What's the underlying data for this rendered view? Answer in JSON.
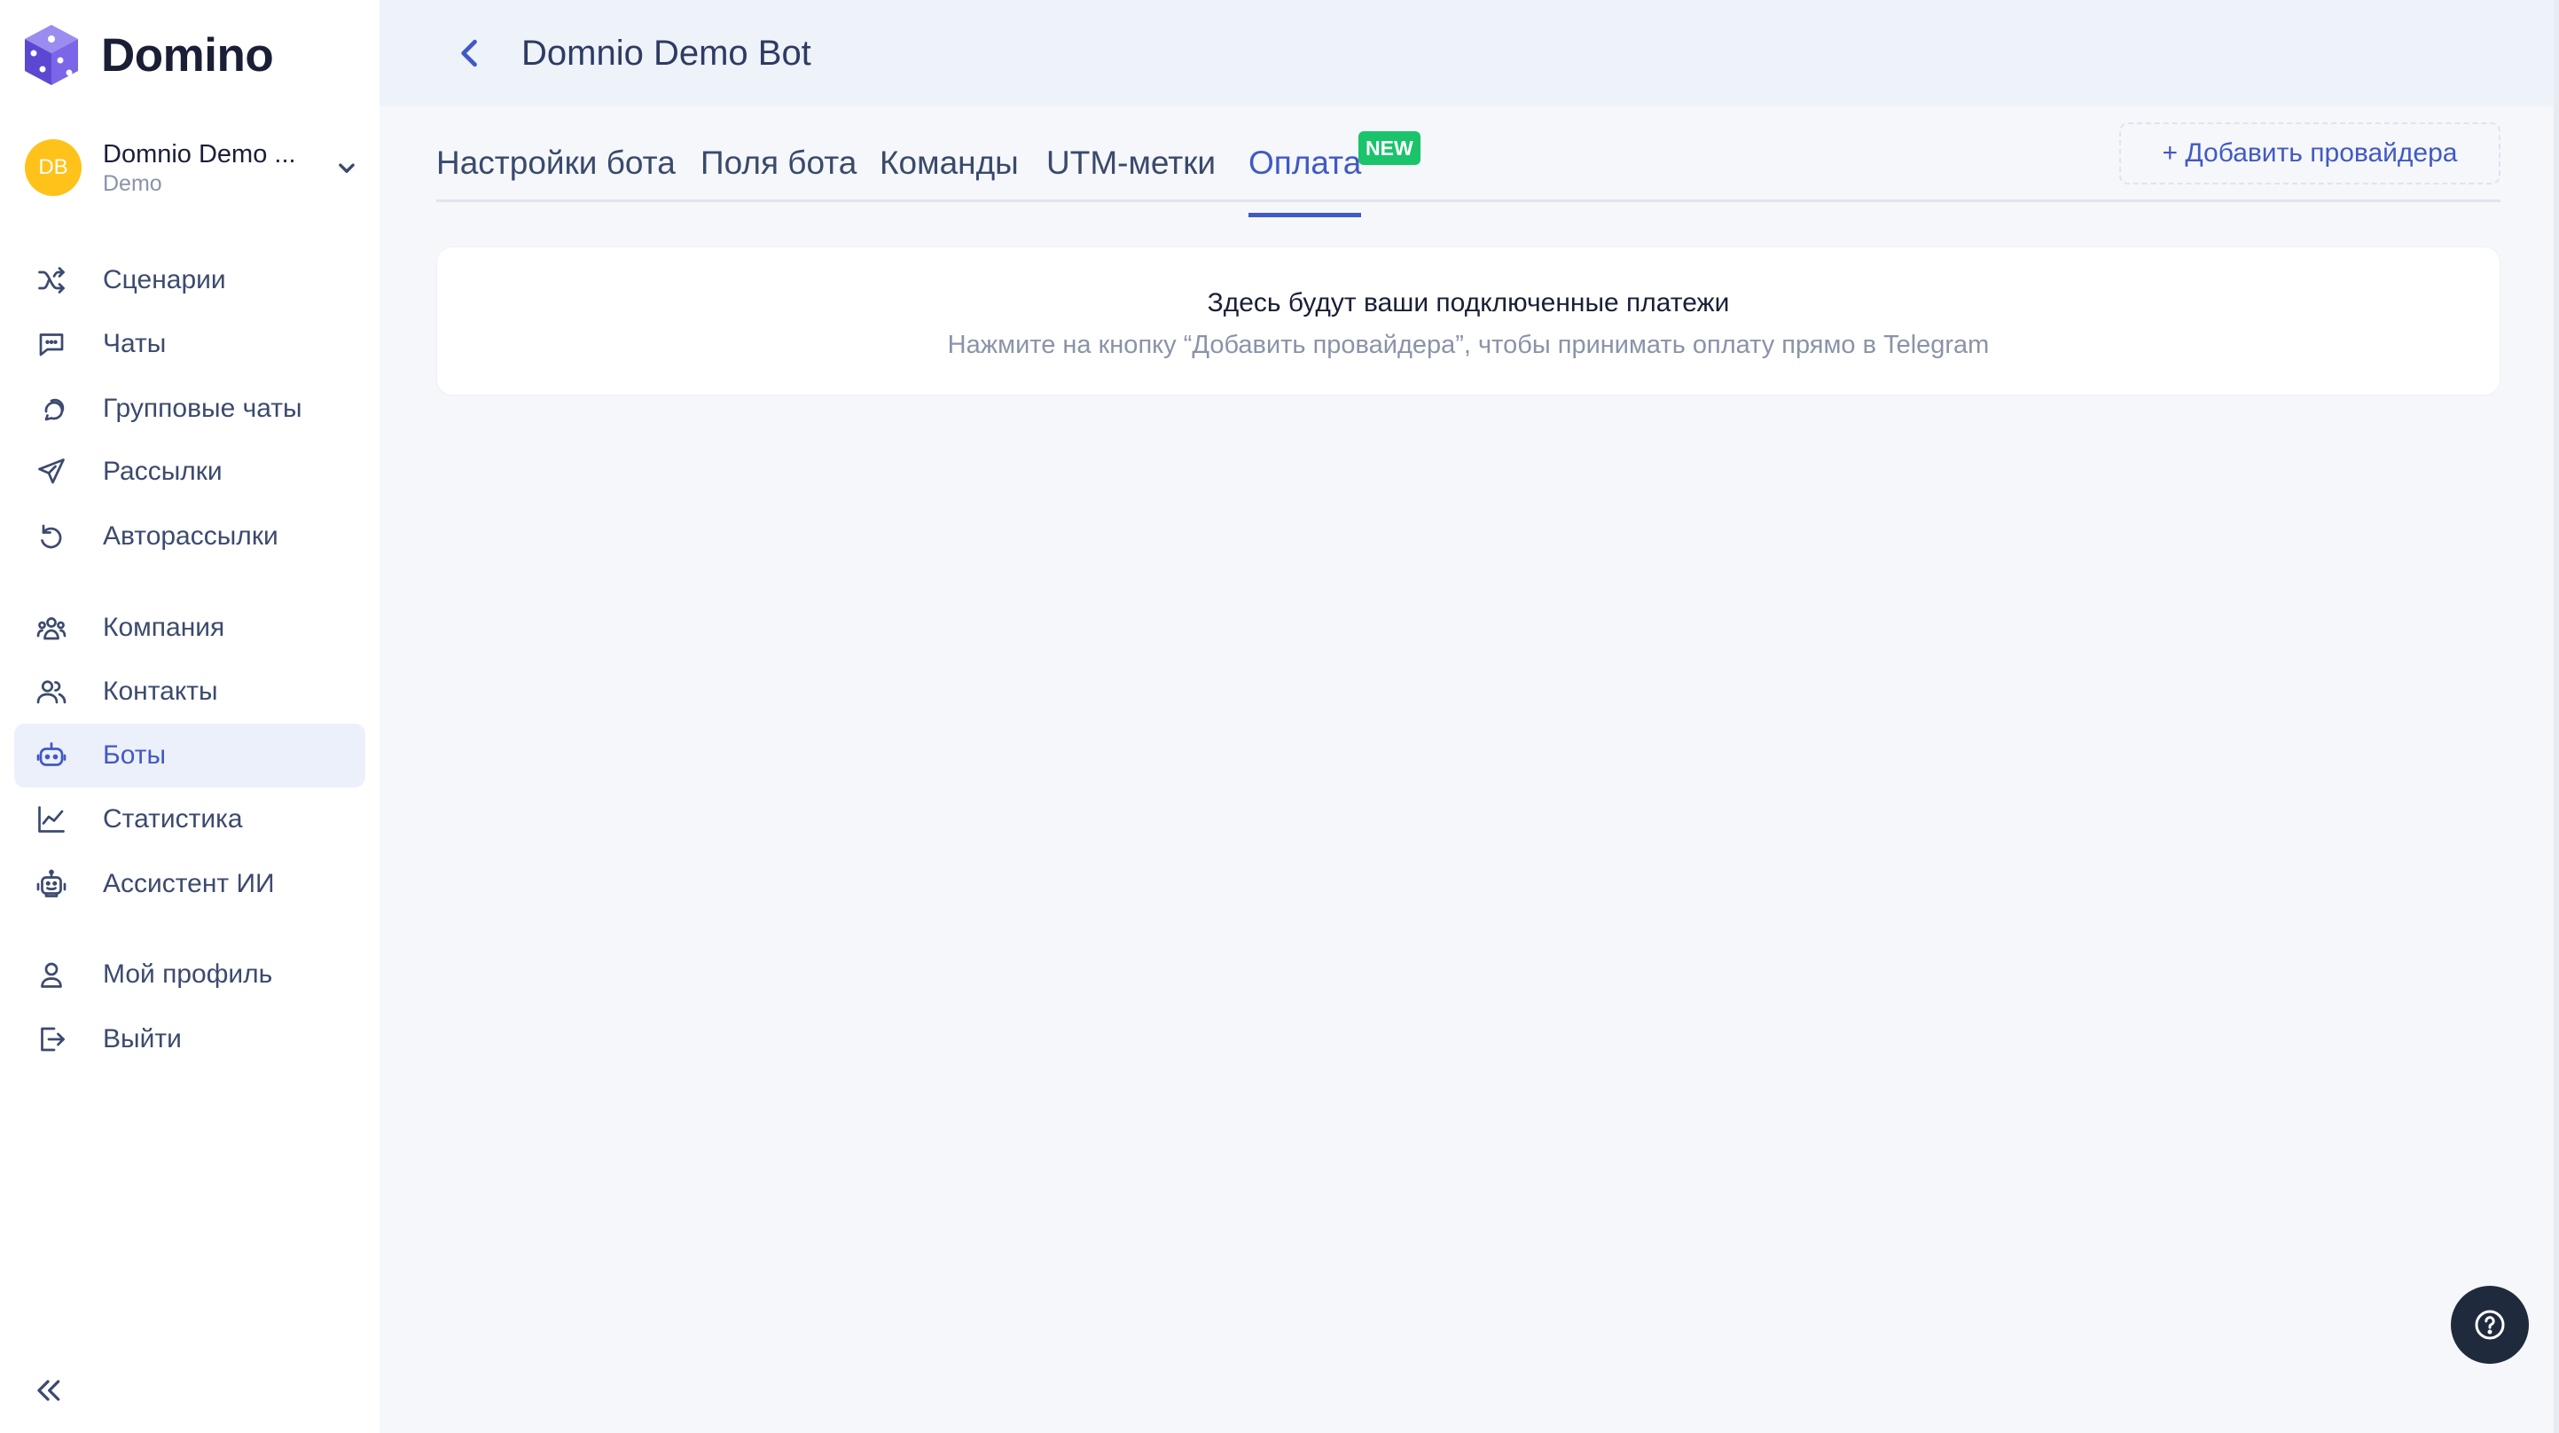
{
  "app": {
    "name": "Domino",
    "accent": "#4159c5",
    "brand": "#6a57d9"
  },
  "account": {
    "initials": "DB",
    "name": "Domnio Demo ...",
    "subtitle": "Demo",
    "avatar_color": "#ffc21a"
  },
  "sidebar": {
    "items": [
      {
        "label": "Сценарии",
        "icon": "shuffle-icon"
      },
      {
        "label": "Чаты",
        "icon": "chat-bubble-icon"
      },
      {
        "label": "Групповые чаты",
        "icon": "group-chat-icon"
      },
      {
        "label": "Рассылки",
        "icon": "send-icon"
      },
      {
        "label": "Авторассылки",
        "icon": "refresh-icon"
      },
      {
        "label": "Компания",
        "icon": "team-icon"
      },
      {
        "label": "Контакты",
        "icon": "contacts-icon"
      },
      {
        "label": "Боты",
        "icon": "bot-icon",
        "active": true
      },
      {
        "label": "Статистика",
        "icon": "chart-icon"
      },
      {
        "label": "Ассистент ИИ",
        "icon": "ai-assistant-icon"
      },
      {
        "label": "Мой профиль",
        "icon": "user-icon"
      },
      {
        "label": "Выйти",
        "icon": "logout-icon"
      }
    ],
    "collapse_icon": "double-chevron-left-icon"
  },
  "header": {
    "title": "Domnio Demo Bot",
    "back_icon": "chevron-left-icon"
  },
  "tabs": [
    {
      "label": "Настройки бота"
    },
    {
      "label": "Поля бота"
    },
    {
      "label": "Команды"
    },
    {
      "label": "UTM-метки"
    },
    {
      "label": "Оплата",
      "active": true,
      "badge": "NEW"
    }
  ],
  "actions": {
    "add_provider": "+ Добавить провайдера"
  },
  "empty_state": {
    "title": "Здесь будут ваши подключенные платежи",
    "subtitle": "Нажмите на кнопку “Добавить провайдера”, чтобы принимать оплату прямо в Telegram"
  },
  "help": {
    "icon": "help-icon"
  }
}
